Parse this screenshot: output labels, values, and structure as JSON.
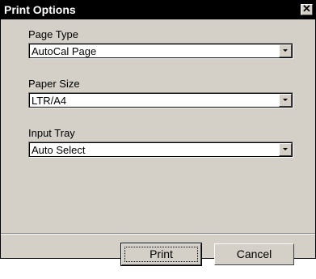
{
  "window": {
    "title": "Print Options",
    "close_glyph": "✕"
  },
  "fields": {
    "page_type": {
      "label": "Page Type",
      "value": "AutoCal Page"
    },
    "paper_size": {
      "label": "Paper Size",
      "value": "LTR/A4"
    },
    "input_tray": {
      "label": "Input Tray",
      "value": "Auto Select"
    }
  },
  "buttons": {
    "print": "Print",
    "cancel": "Cancel"
  },
  "icons": {
    "close": "close-icon",
    "dropdown": "chevron-down-icon"
  },
  "colors": {
    "titlebar": "#000000",
    "title_text": "#ffffff",
    "face": "#d4d0c8"
  }
}
